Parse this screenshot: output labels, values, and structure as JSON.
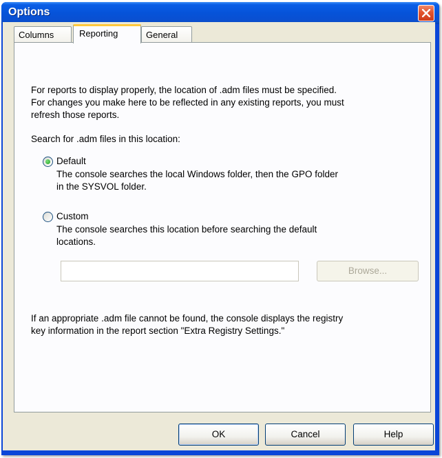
{
  "window": {
    "title": "Options",
    "close_label": "×"
  },
  "tabs": [
    {
      "label": "Columns",
      "selected": false
    },
    {
      "label": "Reporting",
      "selected": true
    },
    {
      "label": "General",
      "selected": false
    }
  ],
  "reporting": {
    "intro_lines": [
      "For reports to display properly, the location of .adm files must be specified.",
      "For changes you make here to be reflected in any existing reports, you must",
      "refresh those reports."
    ],
    "search_label": "Search for .adm files in this location:",
    "default_option": {
      "label": "Default",
      "selected": true,
      "description_lines": [
        "The console searches the local Windows folder, then the GPO folder",
        "in the SYSVOL folder."
      ]
    },
    "custom_option": {
      "label": "Custom",
      "selected": false,
      "description_lines": [
        "The console searches this location before searching the default",
        "locations."
      ],
      "path_value": "",
      "browse_label": "Browse..."
    },
    "footer_lines": [
      "If an appropriate .adm file cannot be found, the console displays the registry",
      "key information in the report section \"Extra Registry Settings.\""
    ]
  },
  "buttons": {
    "ok": "OK",
    "cancel": "Cancel",
    "help": "Help"
  },
  "colors": {
    "titlebar": "#0653d9",
    "dialog_bg": "#ece9d8",
    "tab_highlight": "#ffc83c",
    "close_button": "#e2542e"
  },
  "icons": [
    "close-icon"
  ]
}
